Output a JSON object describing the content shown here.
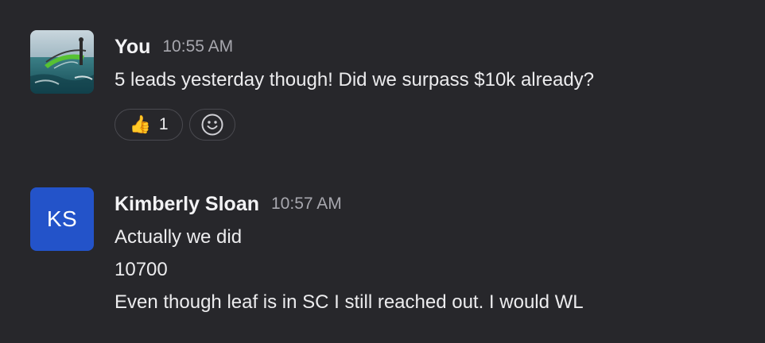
{
  "messages": [
    {
      "sender": "You",
      "time": "10:55 AM",
      "avatar": "photo",
      "lines": [
        "5 leads yesterday though! Did we surpass $10k already?"
      ],
      "reactions": [
        {
          "emoji": "👍",
          "icon": "thumbs-up-icon",
          "count": "1"
        }
      ],
      "add_reaction_icon": "smiley-icon"
    },
    {
      "sender": "Kimberly Sloan",
      "time": "10:57 AM",
      "avatar": "initials",
      "initials": "KS",
      "avatar_color": "#2353c9",
      "lines": [
        "Actually we did",
        "10700",
        "Even though leaf is in SC I still reached out. I would WL"
      ]
    }
  ]
}
